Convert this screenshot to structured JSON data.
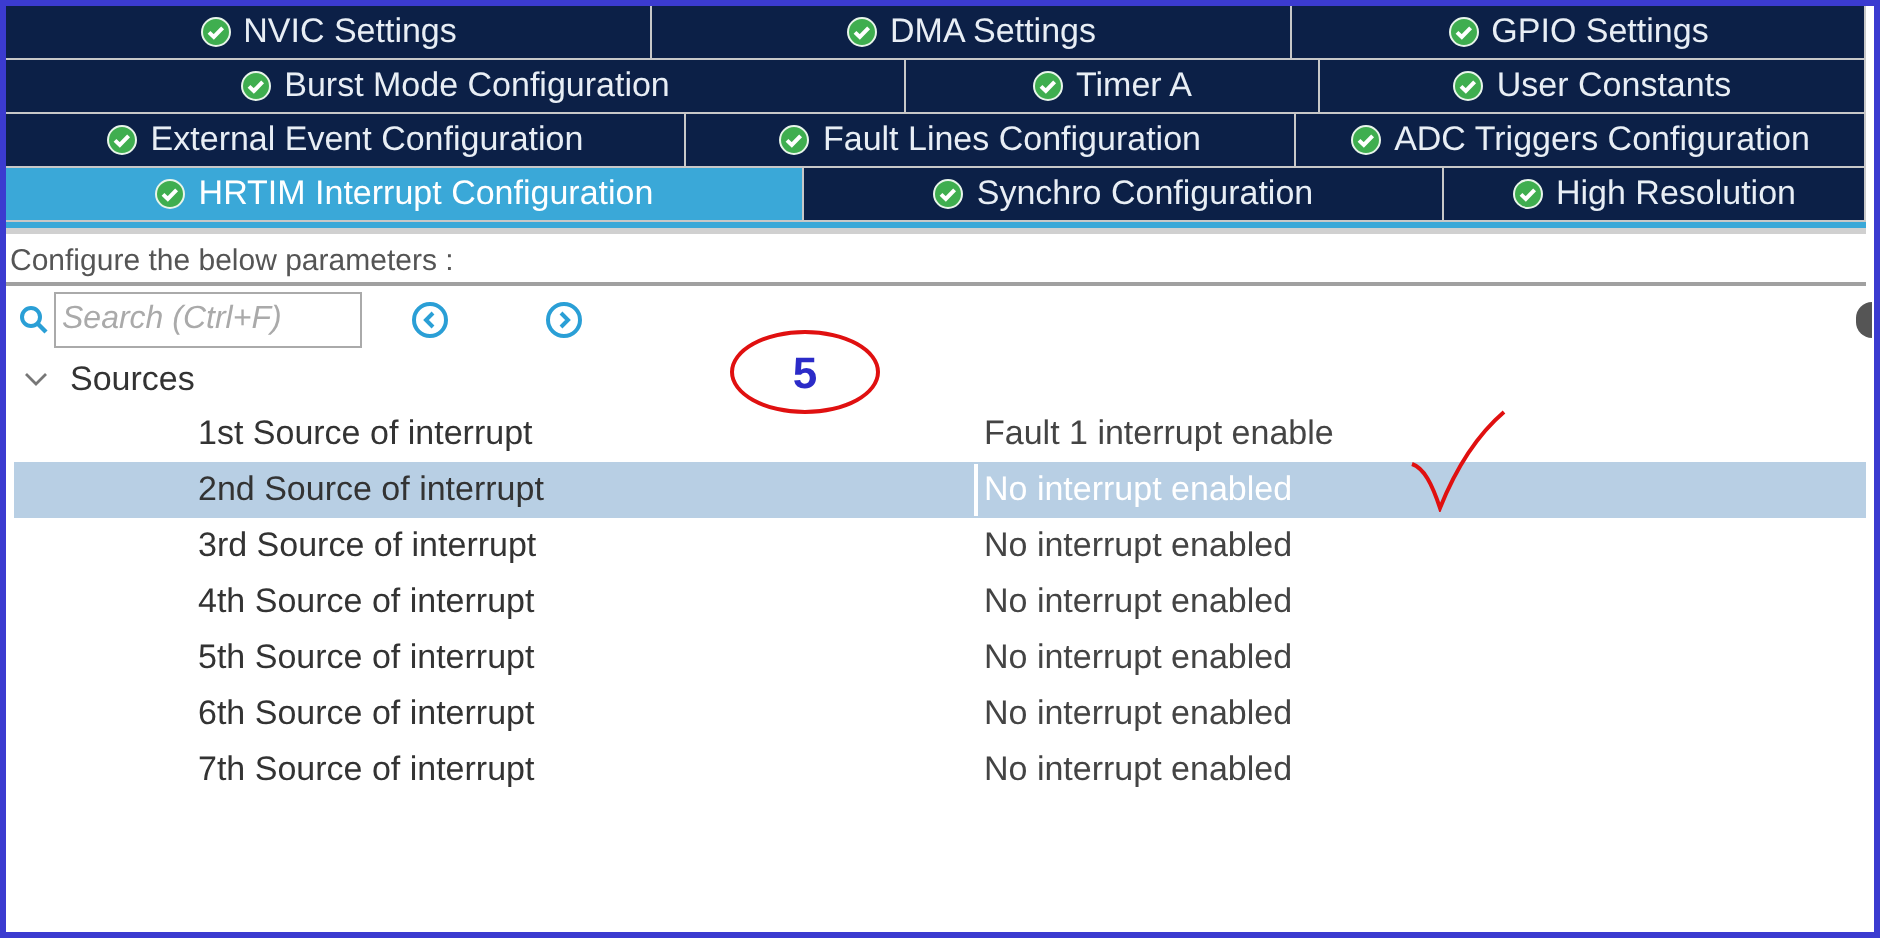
{
  "tab_rows": [
    [
      {
        "label": "NVIC Settings",
        "selected": false
      },
      {
        "label": "DMA Settings",
        "selected": false
      },
      {
        "label": "GPIO Settings",
        "selected": false
      }
    ],
    [
      {
        "label": "Burst Mode Configuration",
        "selected": false
      },
      {
        "label": "Timer A",
        "selected": false
      },
      {
        "label": "User Constants",
        "selected": false
      }
    ],
    [
      {
        "label": "External Event Configuration",
        "selected": false
      },
      {
        "label": "Fault Lines Configuration",
        "selected": false
      },
      {
        "label": "ADC Triggers Configuration",
        "selected": false
      }
    ],
    [
      {
        "label": "HRTIM Interrupt Configuration",
        "selected": true
      },
      {
        "label": "Synchro Configuration",
        "selected": false
      },
      {
        "label": "High Resolution",
        "selected": false
      }
    ]
  ],
  "heading": "Configure the below parameters :",
  "search": {
    "placeholder": "Search (Ctrl+F)"
  },
  "tree": {
    "label": "Sources",
    "expanded": true,
    "children": [
      {
        "label": "1st Source of interrupt",
        "value": "Fault 1 interrupt enable",
        "selected": false
      },
      {
        "label": "2nd Source of interrupt",
        "value": "No interrupt enabled",
        "selected": true
      },
      {
        "label": "3rd Source of interrupt",
        "value": "No interrupt enabled",
        "selected": false
      },
      {
        "label": "4th Source of interrupt",
        "value": "No interrupt enabled",
        "selected": false
      },
      {
        "label": "5th Source of interrupt",
        "value": "No interrupt enabled",
        "selected": false
      },
      {
        "label": "6th Source of interrupt",
        "value": "No interrupt enabled",
        "selected": false
      },
      {
        "label": "7th Source of interrupt",
        "value": "No interrupt enabled",
        "selected": false
      }
    ]
  },
  "annotation": {
    "text": "5"
  }
}
